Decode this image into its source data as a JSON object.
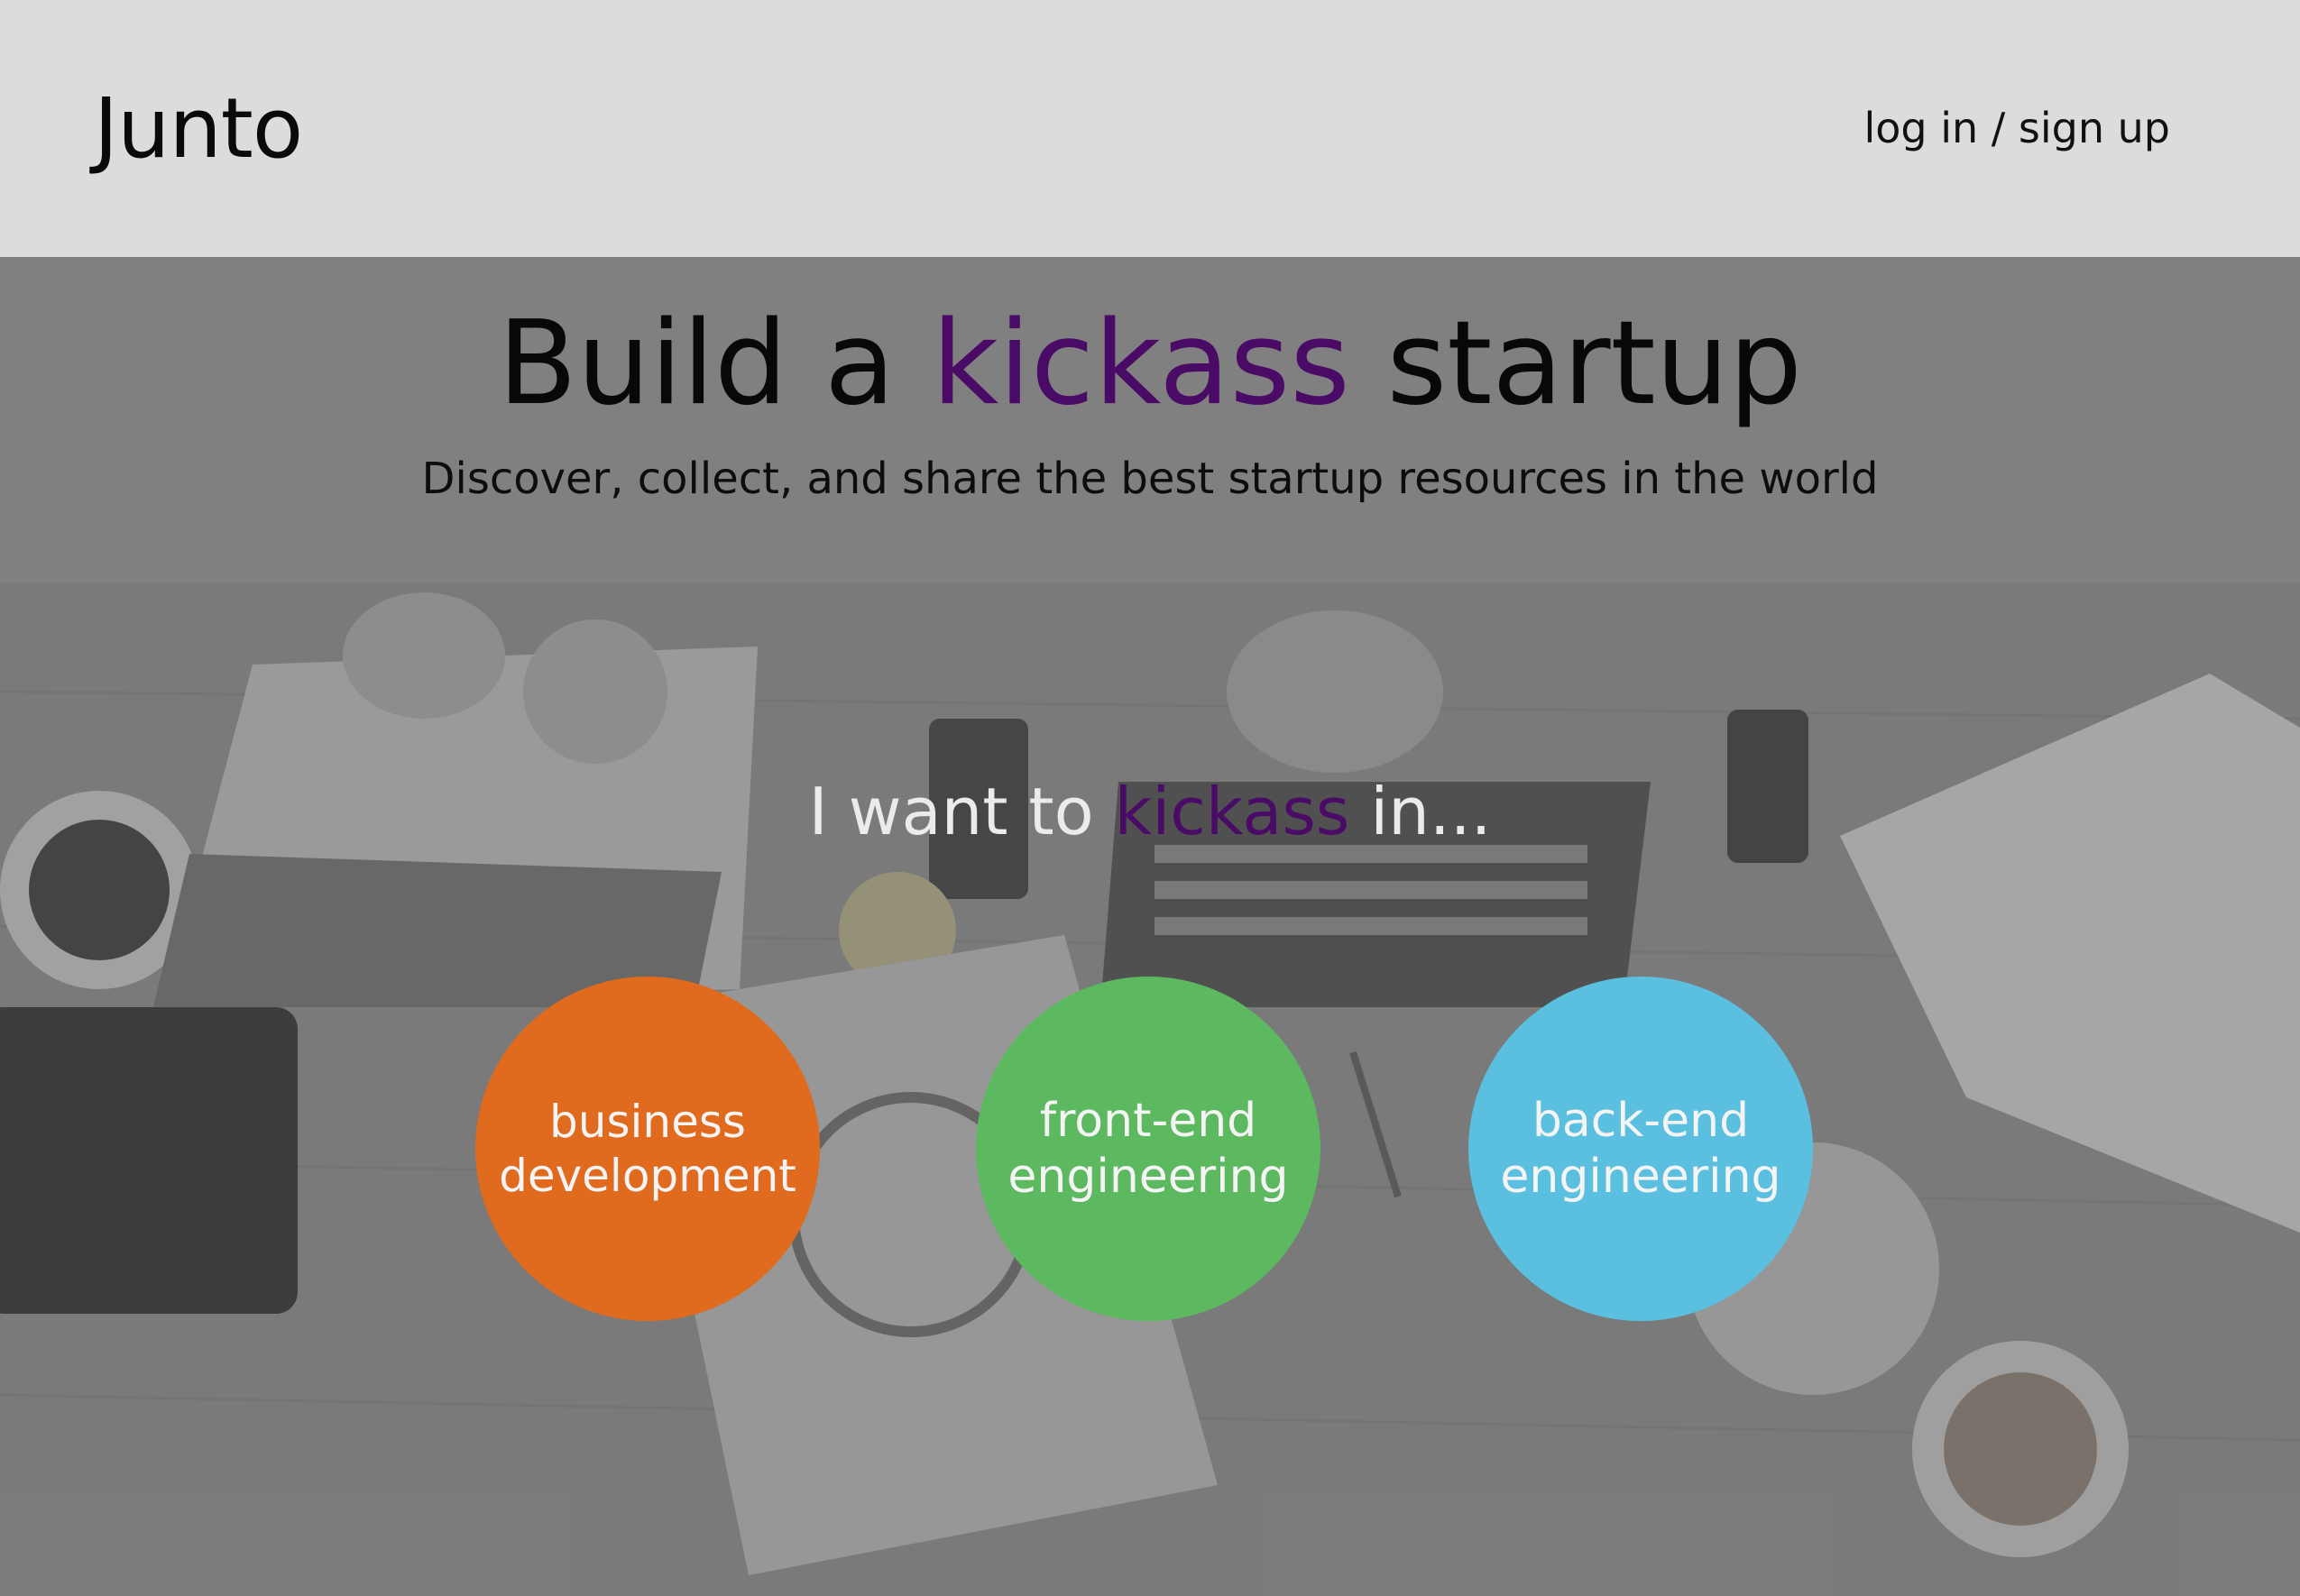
{
  "header": {
    "logo": "Junto",
    "auth_link": "log in / sign up"
  },
  "hero": {
    "title_before": "Build a ",
    "title_accent": "kickass",
    "title_after": " startup",
    "subtitle": "Discover, collect, and share the best startup resources in the world"
  },
  "prompt": {
    "before": "I want to ",
    "accent": "kickass",
    "after": " in..."
  },
  "categories": [
    {
      "line1": "business",
      "line2": "development",
      "color": "#e06a1d"
    },
    {
      "line1": "front-end",
      "line2": "engineering",
      "color": "#5cb95f"
    },
    {
      "line1": "back-end",
      "line2": "engineering",
      "color": "#5bbfe0"
    }
  ],
  "colors": {
    "accent": "#4a0b66",
    "header_bg": "#dcdcdc",
    "hero_bg": "#808080"
  },
  "background_image": "desk-with-laptops-phones-coffee-photo"
}
